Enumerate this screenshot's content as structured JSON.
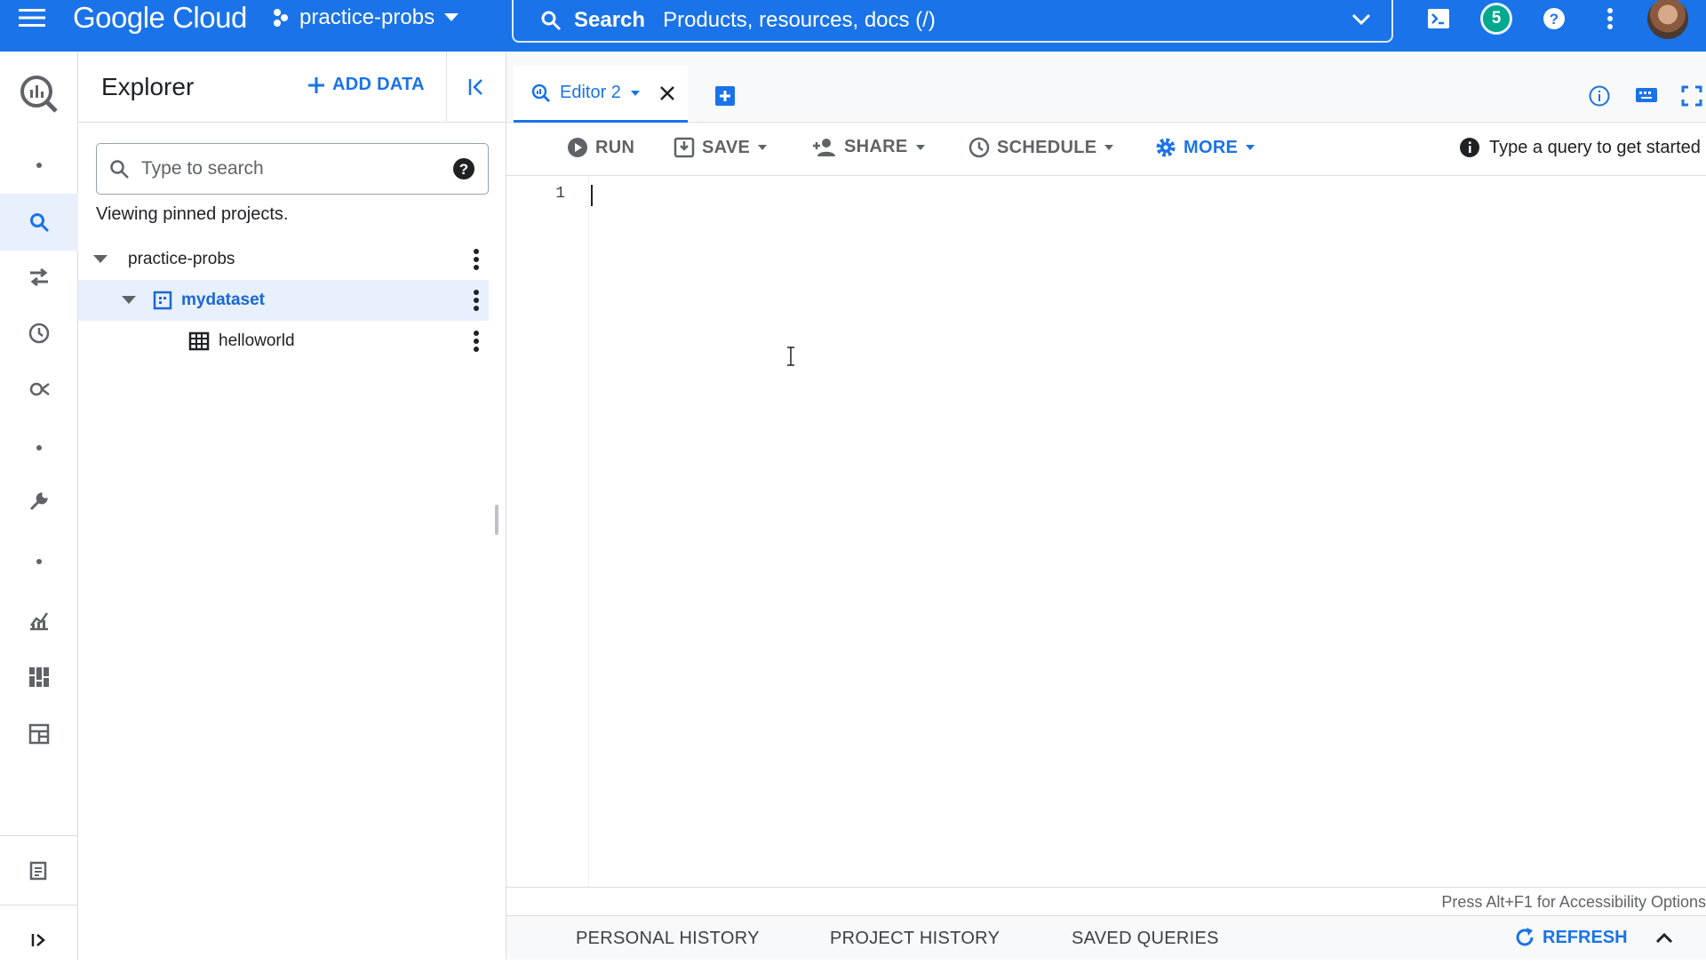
{
  "topbar": {
    "logo": "Google Cloud",
    "project": "practice-probs",
    "search_label": "Search",
    "search_placeholder": "Products, resources, docs (/)",
    "notification_count": "5"
  },
  "explorer": {
    "title": "Explorer",
    "add_data": "ADD DATA",
    "search_placeholder": "Type to search",
    "viewing_text": "Viewing pinned projects.",
    "tree": [
      {
        "label": "practice-probs"
      },
      {
        "label": "mydataset"
      },
      {
        "label": "helloworld"
      }
    ]
  },
  "editor": {
    "tab_label": "Editor 2",
    "toolbar": {
      "run": "RUN",
      "save": "SAVE",
      "share": "SHARE",
      "schedule": "SCHEDULE",
      "more": "MORE"
    },
    "hint": "Type a query to get started",
    "line_number": "1",
    "accessibility_hint": "Press Alt+F1 for Accessibility Options"
  },
  "bottom": {
    "tabs": [
      "PERSONAL HISTORY",
      "PROJECT HISTORY",
      "SAVED QUERIES"
    ],
    "refresh": "REFRESH"
  },
  "colors": {
    "brand_blue": "#1a73e8",
    "badge_teal": "#00a88f"
  }
}
